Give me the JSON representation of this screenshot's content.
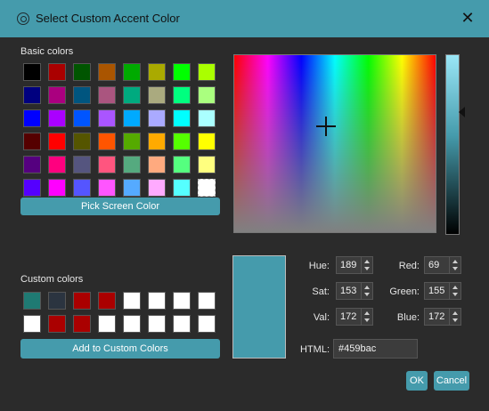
{
  "window": {
    "title": "Select Custom Accent Color",
    "close_icon": "close-icon"
  },
  "basic_colors": {
    "label": "Basic colors",
    "swatches": [
      "#000000",
      "#aa0000",
      "#005500",
      "#aa5500",
      "#00aa00",
      "#aaaa00",
      "#00ff00",
      "#aaff00",
      "#00007f",
      "#aa007f",
      "#00557f",
      "#aa557f",
      "#00aa7f",
      "#aaaa7f",
      "#00ff7f",
      "#aaff7f",
      "#0000ff",
      "#aa00ff",
      "#0055ff",
      "#aa55ff",
      "#00aaff",
      "#aaaaff",
      "#00ffff",
      "#aaffff",
      "#550000",
      "#ff0000",
      "#555500",
      "#ff5500",
      "#55aa00",
      "#ffaa00",
      "#55ff00",
      "#ffff00",
      "#55007f",
      "#ff007f",
      "#55557f",
      "#ff557f",
      "#55aa7f",
      "#ffaa7f",
      "#55ff7f",
      "#ffff7f",
      "#5500ff",
      "#ff00ff",
      "#5555ff",
      "#ff55ff",
      "#55aaff",
      "#ffaaff",
      "#55ffff",
      "#ffffff"
    ],
    "selected_index": 47
  },
  "pick_screen_color": {
    "label": "Pick Screen Color"
  },
  "custom_colors": {
    "label": "Custom colors",
    "swatches": [
      "#1f7a73",
      "#2b3440",
      "#aa0000",
      "#aa0000",
      "#ffffff",
      "#ffffff",
      "#ffffff",
      "#ffffff",
      "#ffffff",
      "#aa0000",
      "#aa0000",
      "#ffffff",
      "#ffffff",
      "#ffffff",
      "#ffffff",
      "#ffffff"
    ]
  },
  "add_custom": {
    "label": "Add to Custom Colors"
  },
  "current_color": "#459bac",
  "fields": {
    "hue": {
      "label": "Hue:",
      "value": "189"
    },
    "sat": {
      "label": "Sat:",
      "value": "153"
    },
    "val": {
      "label": "Val:",
      "value": "172"
    },
    "red": {
      "label": "Red:",
      "value": "69"
    },
    "green": {
      "label": "Green:",
      "value": "155"
    },
    "blue": {
      "label": "Blue:",
      "value": "172"
    }
  },
  "html": {
    "label": "HTML:",
    "value": "#459bac"
  },
  "buttons": {
    "ok": "OK",
    "cancel": "Cancel"
  }
}
